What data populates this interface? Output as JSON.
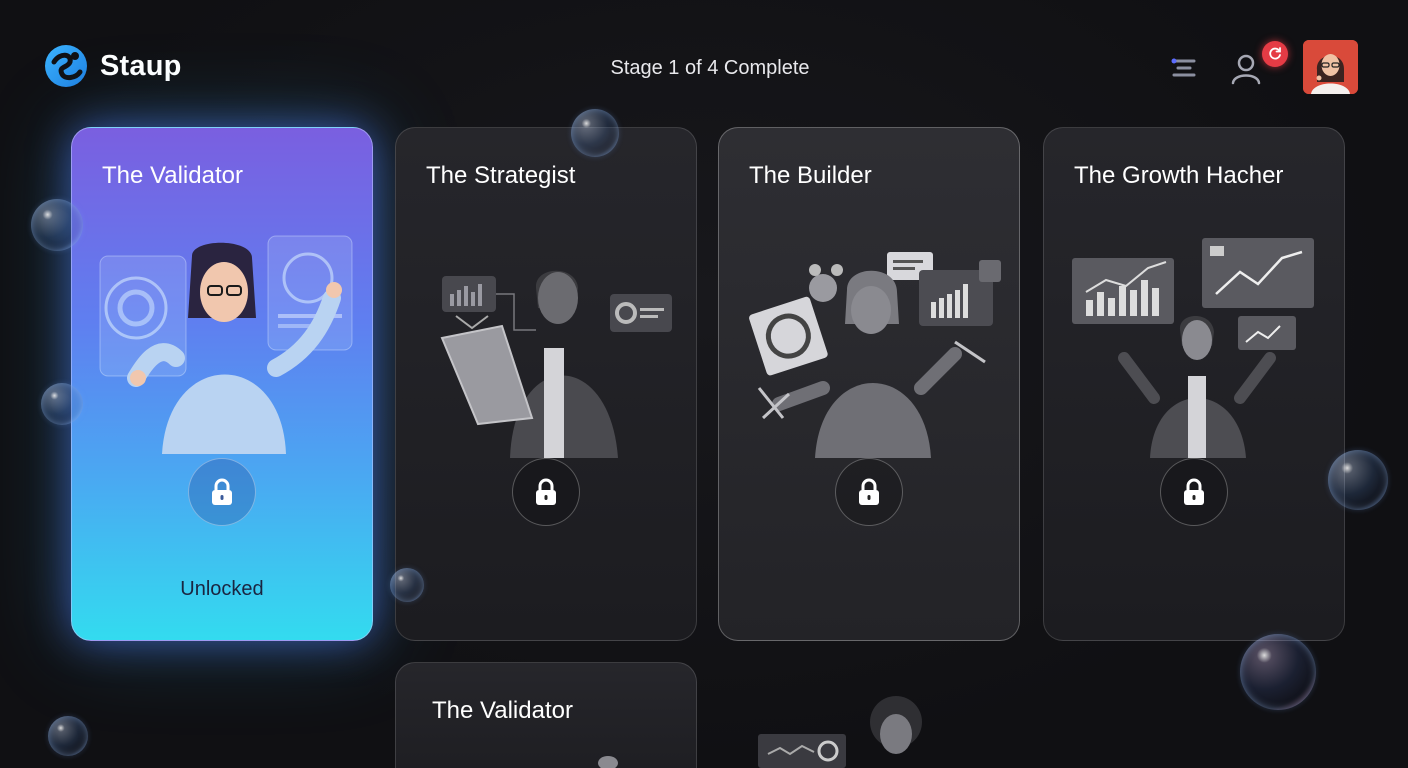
{
  "app": {
    "name": "Staup"
  },
  "header": {
    "progress_text": "Stage 1 of 4 Complete"
  },
  "colors": {
    "accent_start": "#7a5fe0",
    "accent_end": "#33dbef",
    "badge": "#e53b45",
    "background": "#111114"
  },
  "icons": {
    "logo": "staup-logo-icon",
    "filter": "filter-icon",
    "user": "user-icon",
    "notification": "refresh-icon",
    "lock": "lock-icon"
  },
  "cards": [
    {
      "title": "The Validator",
      "status": "Unlocked",
      "locked": false
    },
    {
      "title": "The Strategist",
      "status": "",
      "locked": true
    },
    {
      "title": "The Builder",
      "status": "",
      "locked": true
    },
    {
      "title": "The Growth Hacher",
      "status": "",
      "locked": true
    }
  ],
  "second_row": [
    {
      "title": "The Validator"
    }
  ]
}
